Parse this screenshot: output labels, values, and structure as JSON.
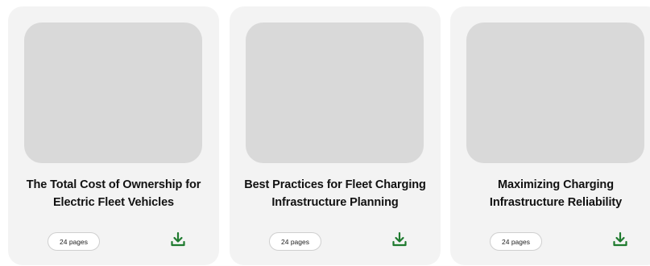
{
  "cards": [
    {
      "title": "The Total Cost of Ownership for Electric Fleet Vehicles",
      "pages": "24 pages"
    },
    {
      "title": "Best Practices for Fleet Charging Infrastructure Planning",
      "pages": "24 pages"
    },
    {
      "title": "Maximizing Charging Infrastructure Reliability",
      "pages": "24 pages"
    }
  ],
  "colors": {
    "card_bg": "#f3f3f3",
    "thumbnail_placeholder": "#d9d9d9",
    "download_icon": "#1e7a2e"
  },
  "icons": {
    "download": "download-icon"
  }
}
